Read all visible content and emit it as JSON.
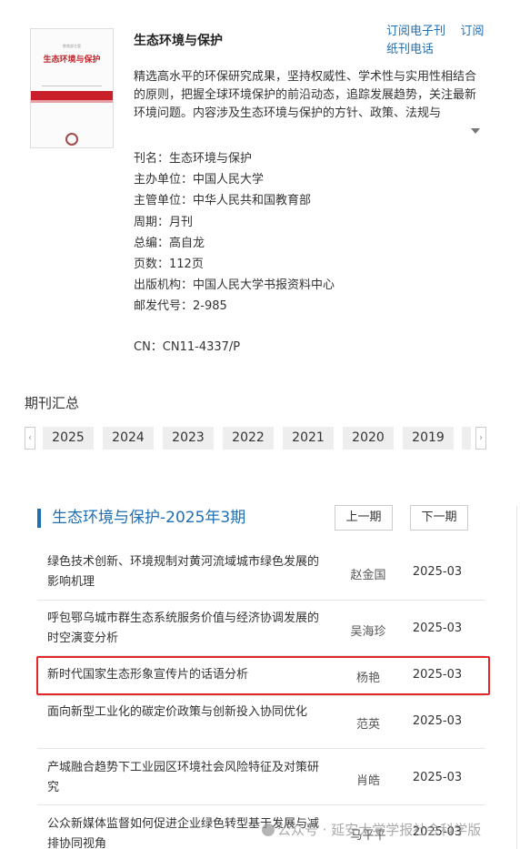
{
  "journal": {
    "cover": {
      "top_text": "教育部主管",
      "title": "生态环境与保护"
    },
    "title": "生态环境与保护",
    "subscribe_electronic": "订阅电子刊",
    "subscribe_paper": "订阅纸刊电话",
    "description": "精选高水平的环保研究成果，坚持权威性、学术性与实用性相结合的原则，把握全球环境保护的前沿动态，追踪发展趋势，关注最新环境问题。内容涉及生态环境与保护的方针、政策、法规与",
    "meta": {
      "name": "刊名：生态环境与保护",
      "sponsor": "主办单位：中国人民大学",
      "supervisor": "主管单位：中华人民共和国教育部",
      "period": "周期：月刊",
      "editor": "总编：高自龙",
      "pages": "页数：112页",
      "publisher": "出版机构：中国人民大学书报资料中心",
      "postal_code": "邮发代号：2-985"
    },
    "cn": "CN：CN11-4337/P"
  },
  "summary": {
    "title": "期刊汇总",
    "years": [
      "2025",
      "2024",
      "2023",
      "2022",
      "2021",
      "2020",
      "2019"
    ]
  },
  "issue": {
    "title": "生态环境与保护-2025年3期",
    "prev_label": "上一期",
    "next_label": "下一期",
    "articles": [
      {
        "title": "绿色技术创新、环境规制对黄河流域城市绿色发展的影响机理",
        "author": "赵金国",
        "date": "2025-03",
        "highlighted": false
      },
      {
        "title": "呼包鄂乌城市群生态系统服务价值与经济协调发展的时空演变分析",
        "author": "吴海珍",
        "date": "2025-03",
        "highlighted": false
      },
      {
        "title": "新时代国家生态形象宣传片的话语分析",
        "author": "杨艳",
        "date": "2025-03",
        "highlighted": true
      },
      {
        "title": "面向新型工业化的碳定价政策与创新投入协同优化",
        "author": "范英",
        "date": "2025-03",
        "highlighted": false
      },
      {
        "title": "产城融合趋势下工业园区环境社会风险特征及对策研究",
        "author": "肖皓",
        "date": "2025-03",
        "highlighted": false
      },
      {
        "title": "公众新媒体监督如何促进企业绿色转型基于发展与减排协同视角",
        "author": "马平平",
        "date": "2025-03",
        "highlighted": false
      }
    ]
  },
  "watermark": "公众号 · 延安大学学报社会科学版"
}
